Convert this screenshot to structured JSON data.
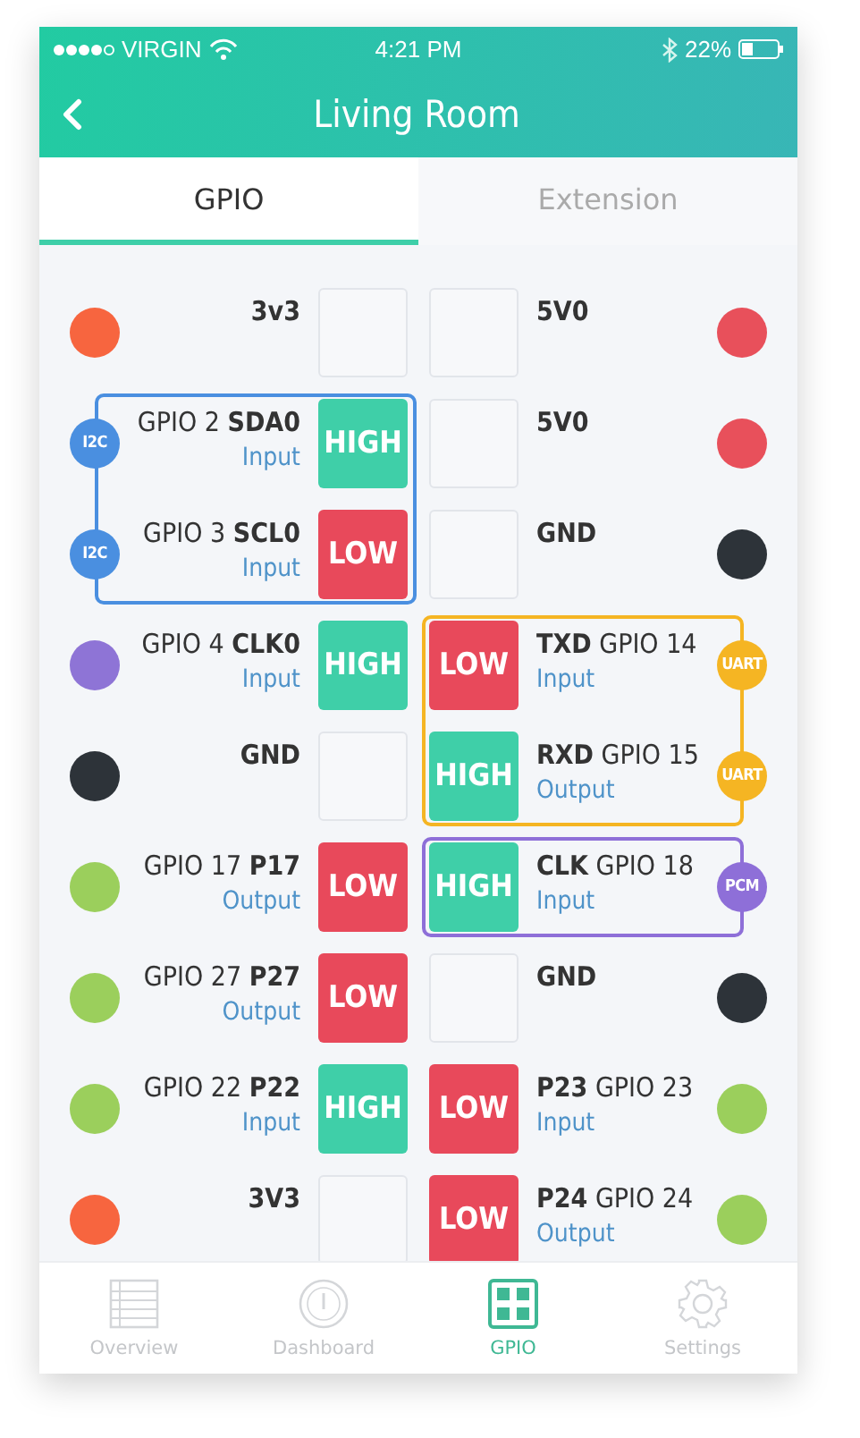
{
  "status_bar": {
    "carrier": "VIRGIN",
    "time": "4:21 PM",
    "battery": "22%"
  },
  "header": {
    "title": "Living Room"
  },
  "tabs": [
    {
      "label": "GPIO",
      "selected": true
    },
    {
      "label": "Extension",
      "selected": false
    }
  ],
  "rows": [
    {
      "left": {
        "kind": "power",
        "name": "3v3",
        "color": "#f7653f"
      },
      "right": {
        "kind": "power",
        "name": "5V0",
        "color": "#e8505b"
      }
    },
    {
      "left": {
        "kind": "gpio",
        "name": "GPIO 2 **SDA0**",
        "mode": "Input",
        "high": true,
        "value": "HIGH",
        "badge": "I2C",
        "color": "#4a8fe0",
        "group_start": true,
        "group_end": false
      },
      "right": {
        "kind": "power",
        "name": "5V0",
        "color": "#e8505b"
      }
    },
    {
      "left": {
        "kind": "gpio",
        "name": "GPIO 3 **SCL0**",
        "mode": "Input",
        "high": false,
        "value": "LOW",
        "badge": "I2C",
        "color": "#4a8fe0",
        "group_start": false,
        "group_end": true
      },
      "right": {
        "kind": "power",
        "name": "GND",
        "color": "#2d3339"
      }
    },
    {
      "left": {
        "kind": "gpio",
        "name": "GPIO 4 **CLK0**",
        "mode": "Input",
        "high": true,
        "value": "HIGH",
        "color": "#8e74d6"
      },
      "right": {
        "kind": "gpio",
        "name": "**TXD** GPIO 14",
        "mode": "Input",
        "high": false,
        "value": "LOW",
        "badge": "UART",
        "color": "#f5b523",
        "group_start": true,
        "group_end": false
      }
    },
    {
      "left": {
        "kind": "power",
        "name": "GND",
        "color": "#2d3339"
      },
      "right": {
        "kind": "gpio",
        "name": "**RXD** GPIO 15",
        "mode": "Output",
        "high": true,
        "value": "HIGH",
        "badge": "UART",
        "color": "#f5b523",
        "group_start": false,
        "group_end": true
      }
    },
    {
      "left": {
        "kind": "gpio",
        "name": "GPIO 17 **P17**",
        "mode": "Output",
        "high": false,
        "value": "LOW",
        "color": "#9bcf5c"
      },
      "right": {
        "kind": "gpio",
        "name": "**CLK** GPIO 18",
        "mode": "Input",
        "high": true,
        "value": "HIGH",
        "badge": "PCM",
        "color": "#8e6fd8",
        "group_start": true,
        "group_end": true
      }
    },
    {
      "left": {
        "kind": "gpio",
        "name": "GPIO 27 **P27**",
        "mode": "Output",
        "high": false,
        "value": "LOW",
        "color": "#9bcf5c"
      },
      "right": {
        "kind": "power",
        "name": "GND",
        "color": "#2d3339"
      }
    },
    {
      "left": {
        "kind": "gpio",
        "name": "GPIO 22 **P22**",
        "mode": "Input",
        "high": true,
        "value": "HIGH",
        "color": "#9bcf5c"
      },
      "right": {
        "kind": "gpio",
        "name": "**P23** GPIO 23",
        "mode": "Input",
        "high": false,
        "value": "LOW",
        "color": "#9bcf5c"
      }
    },
    {
      "left": {
        "kind": "power",
        "name": "3V3",
        "color": "#f7653f"
      },
      "right": {
        "kind": "gpio",
        "name": "**P24** GPIO 24",
        "mode": "Output",
        "high": false,
        "value": "LOW",
        "color": "#9bcf5c"
      }
    }
  ],
  "bottom_nav": [
    {
      "label": "Overview",
      "kind": "list",
      "selected": false
    },
    {
      "label": "Dashboard",
      "kind": "gauge",
      "selected": false
    },
    {
      "label": "GPIO",
      "kind": "grid",
      "selected": true
    },
    {
      "label": "Settings",
      "kind": "gear",
      "selected": false
    }
  ]
}
